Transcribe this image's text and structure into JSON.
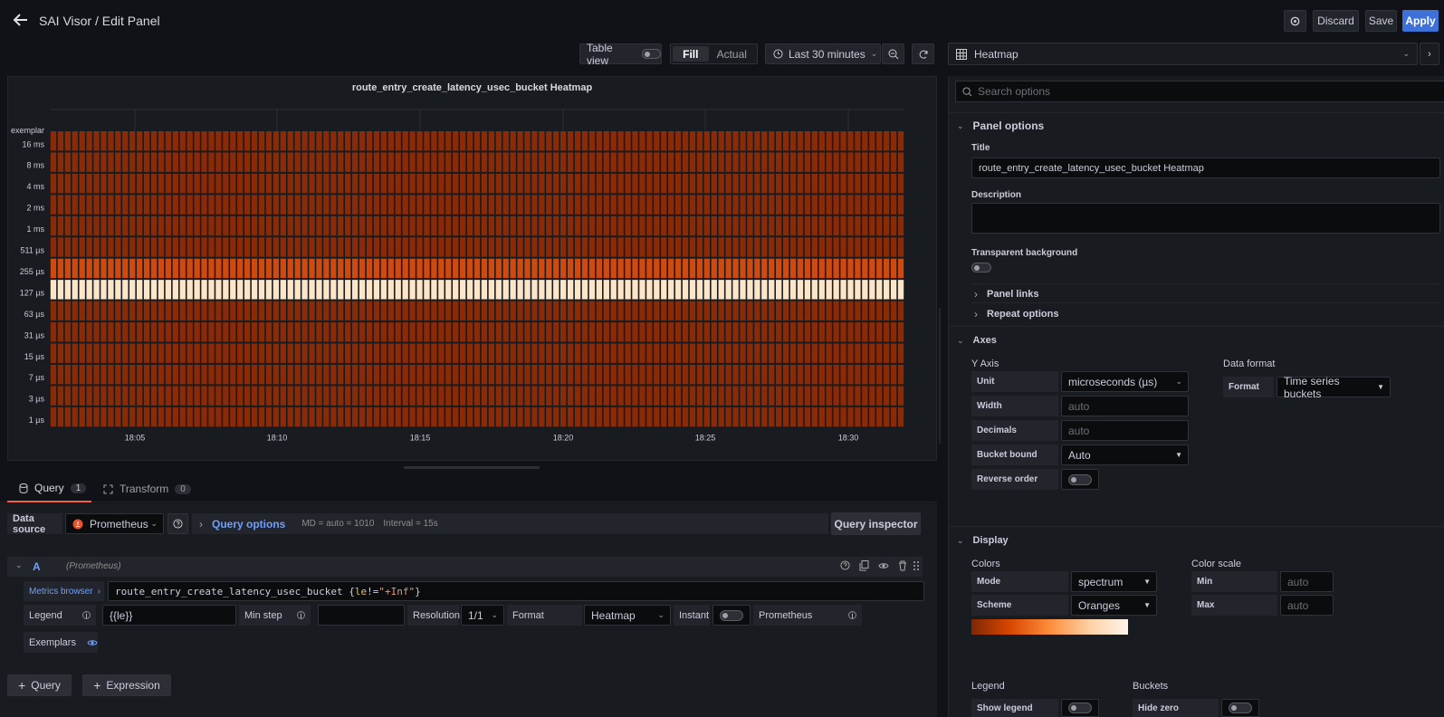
{
  "header": {
    "title": "SAI Visor / Edit Panel",
    "discard": "Discard",
    "save": "Save",
    "apply": "Apply"
  },
  "toolbar": {
    "table_view": "Table view",
    "fill": "Fill",
    "actual": "Actual",
    "time_range": "Last 30 minutes"
  },
  "viz_picker": {
    "selected": "Heatmap"
  },
  "panel": {
    "title": "route_entry_create_latency_usec_bucket Heatmap"
  },
  "chart_data": {
    "type": "heatmap",
    "title": "route_entry_create_latency_usec_bucket Heatmap",
    "y_labels": [
      "exemplar",
      "16 ms",
      "8 ms",
      "4 ms",
      "2 ms",
      "1 ms",
      "511 µs",
      "255 µs",
      "127 µs",
      "63 µs",
      "31 µs",
      "15 µs",
      "7 µs",
      "3 µs",
      "1 µs"
    ],
    "x_ticks": [
      "18:05",
      "18:10",
      "18:15",
      "18:20",
      "18:25",
      "18:30"
    ],
    "columns": 119,
    "rows": [
      {
        "bucket": "16 ms",
        "intensity": 0.2
      },
      {
        "bucket": "8 ms",
        "intensity": 0.2
      },
      {
        "bucket": "4 ms",
        "intensity": 0.2
      },
      {
        "bucket": "2 ms",
        "intensity": 0.2
      },
      {
        "bucket": "1 ms",
        "intensity": 0.2
      },
      {
        "bucket": "511 µs",
        "intensity": 0.2
      },
      {
        "bucket": "255 µs",
        "intensity": 0.55
      },
      {
        "bucket": "127 µs",
        "intensity": 1.0
      },
      {
        "bucket": "63 µs",
        "intensity": 0.2
      },
      {
        "bucket": "31 µs",
        "intensity": 0.2
      },
      {
        "bucket": "15 µs",
        "intensity": 0.2
      },
      {
        "bucket": "7 µs",
        "intensity": 0.2
      },
      {
        "bucket": "3 µs",
        "intensity": 0.2
      },
      {
        "bucket": "1 µs",
        "intensity": 0.2
      }
    ],
    "color_scheme": "Oranges"
  },
  "query_tabs": {
    "query": "Query",
    "query_count": "1",
    "transform": "Transform",
    "transform_count": "0"
  },
  "query_bar": {
    "data_source_label": "Data source",
    "data_source": "Prometheus",
    "query_options": "Query options",
    "md": "MD = auto = 1010",
    "interval": "Interval = 15s",
    "inspector": "Query inspector"
  },
  "query_a": {
    "ref": "A",
    "source": "(Prometheus)",
    "metrics_browser": "Metrics browser",
    "expr_metric": "route_entry_create_latency_usec_bucket ",
    "expr_brace_open": "{",
    "expr_label": "le",
    "expr_op": "!=",
    "expr_value": "\"+Inf\"",
    "expr_brace_close": "}",
    "legend_label": "Legend",
    "legend_value": "{{le}}",
    "min_step_label": "Min step",
    "resolution_label": "Resolution",
    "resolution_value": "1/1",
    "format_label": "Format",
    "format_value": "Heatmap",
    "instant_label": "Instant",
    "prometheus_label": "Prometheus",
    "exemplars_label": "Exemplars"
  },
  "add_buttons": {
    "query": "Query",
    "expression": "Expression"
  },
  "options": {
    "search_placeholder": "Search options",
    "panel_options": "Panel options",
    "title_label": "Title",
    "title_value": "route_entry_create_latency_usec_bucket Heatmap",
    "description_label": "Description",
    "transparent_label": "Transparent background",
    "panel_links": "Panel links",
    "repeat_options": "Repeat options",
    "axes": "Axes",
    "y_axis": "Y Axis",
    "unit_label": "Unit",
    "unit_value": "microseconds (µs)",
    "width_label": "Width",
    "width_ph": "auto",
    "decimals_label": "Decimals",
    "decimals_ph": "auto",
    "bucket_bound_label": "Bucket bound",
    "bucket_bound_value": "Auto",
    "reverse_order_label": "Reverse order",
    "data_format": "Data format",
    "format_label": "Format",
    "format_value": "Time series buckets",
    "display": "Display",
    "colors": "Colors",
    "mode_label": "Mode",
    "mode_value": "spectrum",
    "scheme_label": "Scheme",
    "scheme_value": "Oranges",
    "color_scale": "Color scale",
    "min_label": "Min",
    "min_ph": "auto",
    "max_label": "Max",
    "max_ph": "auto",
    "legend": "Legend",
    "show_legend_label": "Show legend",
    "buckets": "Buckets",
    "hide_zero_label": "Hide zero"
  }
}
